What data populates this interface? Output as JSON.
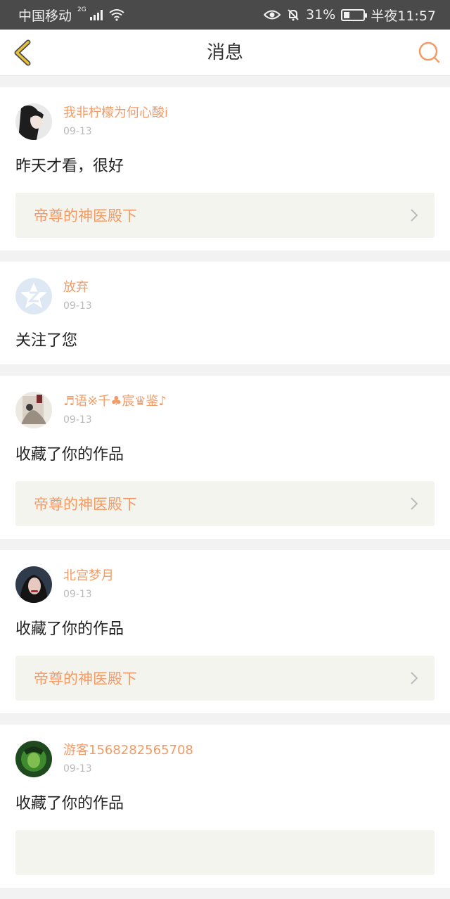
{
  "status_bar": {
    "carrier": "中国移动",
    "network": "2G",
    "battery": "31%",
    "time": "半夜11:57"
  },
  "header": {
    "title": "消息"
  },
  "messages": [
    {
      "username": "我非柠檬为何心酸i",
      "date": "09-13",
      "text": "昨天才看，很好",
      "book": "帝尊的神医殿下"
    },
    {
      "username": "放弃",
      "date": "09-13",
      "text": "关注了您"
    },
    {
      "username": "♬语※千♣宸♛鉴♪",
      "date": "09-13",
      "text": "收藏了你的作品",
      "book": "帝尊的神医殿下"
    },
    {
      "username": "北宫梦月",
      "date": "09-13",
      "text": "收藏了你的作品",
      "book": "帝尊的神医殿下"
    },
    {
      "username": "游客1568282565708",
      "date": "09-13",
      "text": "收藏了你的作品"
    }
  ],
  "colors": {
    "accent": "#f29b66",
    "back_icon": "#e8c23a",
    "status_bar_bg": "#4a4a4a"
  }
}
